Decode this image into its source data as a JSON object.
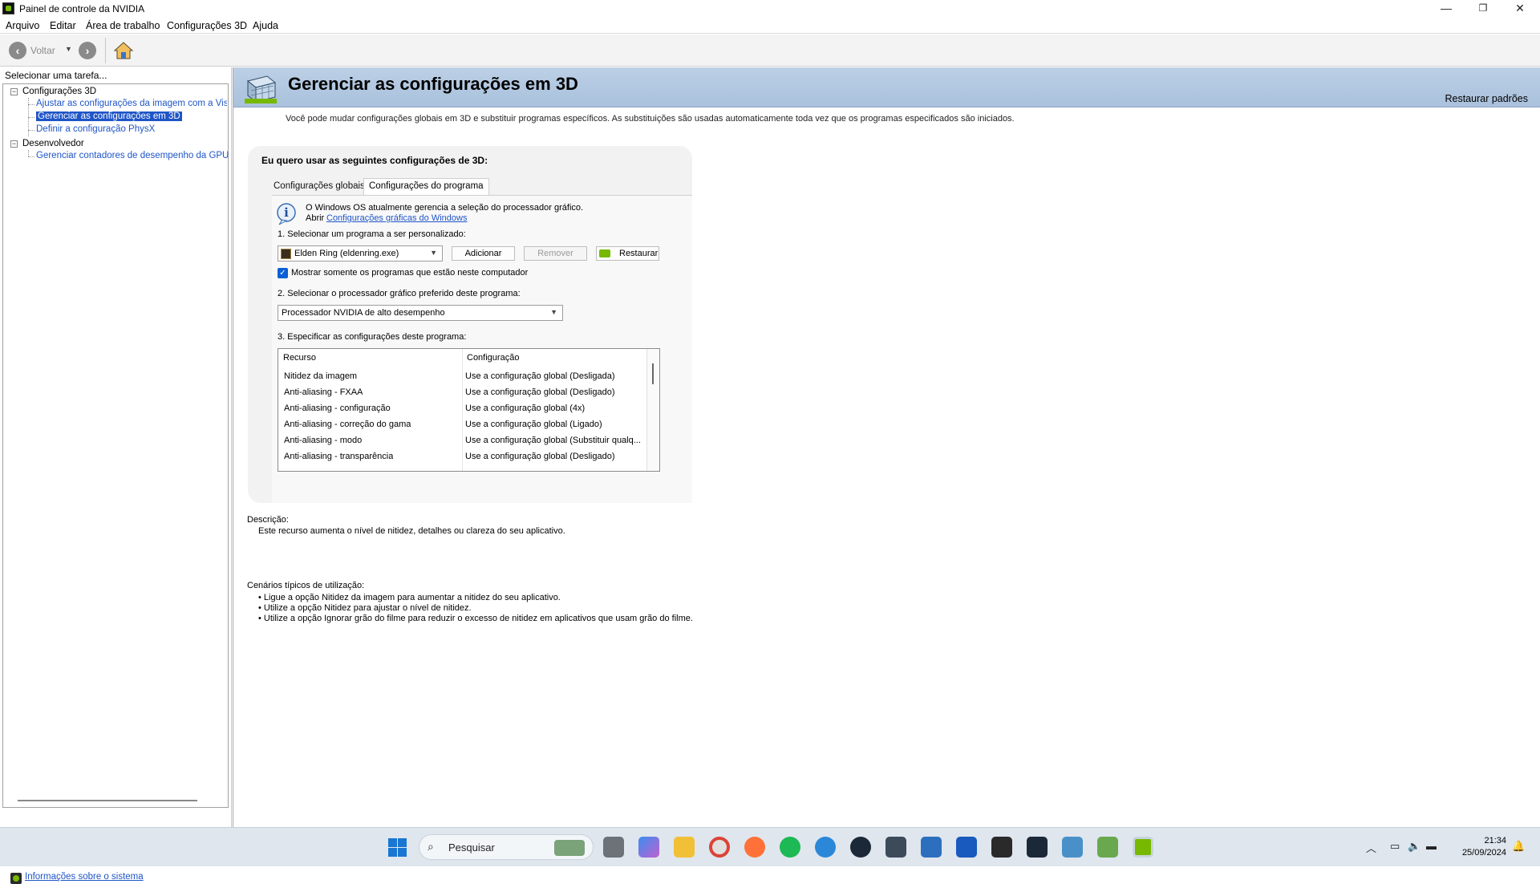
{
  "window": {
    "title": "Painel de controle da NVIDIA",
    "controls": {
      "minimize": "—",
      "maximize": "❐",
      "close": "✕"
    }
  },
  "menu": [
    "Arquivo",
    "Editar",
    "Área de trabalho",
    "Configurações 3D",
    "Ajuda"
  ],
  "toolbar": {
    "back_label": "Voltar"
  },
  "sidebar": {
    "header": "Selecionar uma tarefa...",
    "groups": [
      {
        "label": "Configurações 3D",
        "toggle": "−",
        "items": [
          {
            "label": "Ajustar as configurações da imagem com a Visualização"
          },
          {
            "label": "Gerenciar as configurações em 3D",
            "selected": true
          },
          {
            "label": "Definir a configuração PhysX"
          }
        ]
      },
      {
        "label": "Desenvolvedor",
        "toggle": "−",
        "items": [
          {
            "label": "Gerenciar contadores de desempenho da GPU"
          }
        ]
      }
    ],
    "system_info_link": "Informações sobre o sistema"
  },
  "main": {
    "title": "Gerenciar as configurações em 3D",
    "restore_defaults": "Restaurar padrões",
    "intro": "Você pode mudar configurações globais em 3D e substituir programas específicos. As substituições são usadas automaticamente toda vez que os programas especificados são iniciados.",
    "settings_heading": "Eu quero usar as seguintes configurações de 3D:",
    "tabs": [
      {
        "label": "Configurações globais",
        "active": false
      },
      {
        "label": "Configurações do programa",
        "active": true
      }
    ],
    "info_line1": "O Windows OS atualmente gerencia a seleção do processador gráfico.",
    "info_prefix": "Abrir",
    "info_link": "Configurações gráficas do Windows",
    "step1": "1. Selecionar um programa a ser personalizado:",
    "program_selected": "Elden Ring (eldenring.exe)",
    "buttons": {
      "add": "Adicionar",
      "remove": "Remover",
      "restore": "Restaurar"
    },
    "show_only_installed": "Mostrar somente os programas que estão neste computador",
    "show_only_installed_checked": true,
    "step2": "2. Selecionar o processador gráfico preferido deste programa:",
    "gpu_selected": "Processador NVIDIA de alto desempenho",
    "step3": "3. Especificar as configurações deste programa:",
    "table": {
      "headers": [
        "Recurso",
        "Configuração"
      ],
      "rows": [
        [
          "Nitidez da imagem",
          "Use a configuração global (Desligada)"
        ],
        [
          "Anti-aliasing - FXAA",
          "Use a configuração global (Desligado)"
        ],
        [
          "Anti-aliasing - configuração",
          "Use a configuração global (4x)"
        ],
        [
          "Anti-aliasing - correção do gama",
          "Use a configuração global (Ligado)"
        ],
        [
          "Anti-aliasing - modo",
          "Use a configuração global (Substituir qualq..."
        ],
        [
          "Anti-aliasing - transparência",
          "Use a configuração global (Desligado)"
        ]
      ]
    },
    "description_title": "Descrição:",
    "description_text": "Este recurso aumenta o nível de nitidez, detalhes ou clareza do seu aplicativo.",
    "usage_title": "Cenários típicos de utilização:",
    "usage_items": [
      "Ligue a opção Nitidez da imagem para aumentar a nitidez do seu aplicativo.",
      "Utilize a opção Nitidez para ajustar o nível de nitidez.",
      "Utilize a opção Ignorar grão do filme para reduzir o excesso de nitidez em aplicativos que usam grão do filme."
    ]
  },
  "taskbar": {
    "search_placeholder": "Pesquisar",
    "time": "21:34",
    "date": "25/09/2024"
  },
  "colors": {
    "banner": "#b4cae3",
    "link": "#1f55c7",
    "selection": "#1f55c7",
    "nvidia_green": "#76b900",
    "checkbox": "#0a5ed7"
  }
}
